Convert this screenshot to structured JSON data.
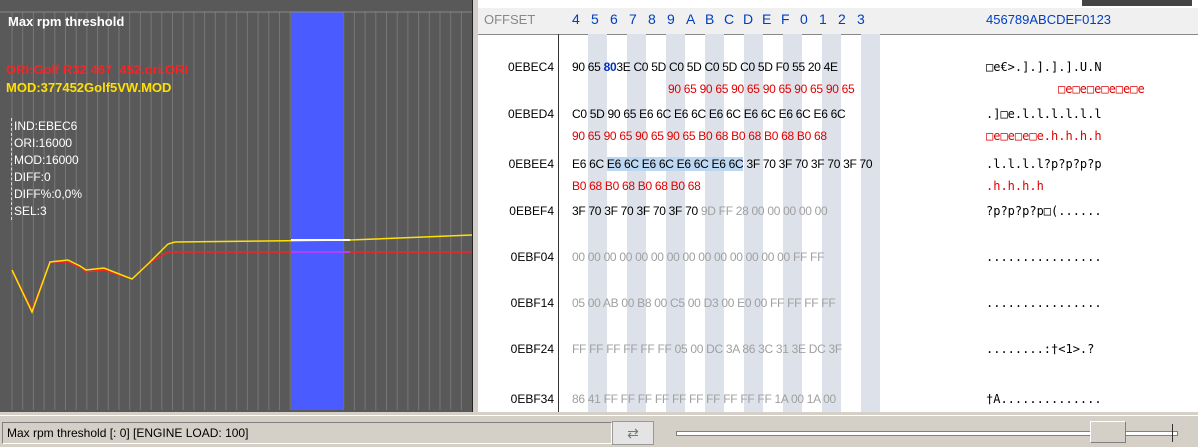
{
  "map": {
    "title": "Max rpm threshold",
    "ori_file": "ORI:Golf R32 467_452.ori.ORI",
    "mod_file": "MOD:377452Golf5VW.MOD",
    "info": [
      "IND:EBEC6",
      "ORI:16000",
      "MOD:16000",
      "DIFF:0",
      "DIFF%:0,0%",
      "SEL:3"
    ],
    "colors": {
      "ori": "#ff2020",
      "mod": "#ffe000",
      "selection": "#4a5cff",
      "diff": "#b040ff"
    }
  },
  "hex": {
    "offset_label": "OFFSET",
    "columns": [
      "4",
      "5",
      "6",
      "7",
      "8",
      "9",
      "A",
      "B",
      "C",
      "D",
      "E",
      "F",
      "0",
      "1",
      "2",
      "3"
    ],
    "ascii_header": "456789ABCDEF0123",
    "rows": [
      {
        "addr": "0EBEC4",
        "pre": "90 65 ",
        "bold": "80",
        "mid": "3E C0 5D C0 5D C0 5D C0 5D F0 55 20 4E",
        "hl": "",
        "post": "",
        "gray": "",
        "ascii": "□e€>.].].].].U.N",
        "diff_hex": "90 65 90 65 90 65 90 65 90 65 90 65",
        "diff_ascii": "□e□e□e□e□e□e"
      },
      {
        "addr": "0EBED4",
        "pre": "C0 5D 90 65 E6 6C E6 6C E6 6C E6 6C E6 6C E6 6C",
        "bold": "",
        "mid": "",
        "hl": "",
        "post": "",
        "gray": "",
        "ascii": ".]□e.l.l.l.l.l.l",
        "diff_hex": "90 65 90 65 90 65 90 65 B0 68 B0 68 B0 68 B0 68",
        "diff_ascii": "□e□e□e□e.h.h.h.h"
      },
      {
        "addr": "0EBEE4",
        "pre": "E6 6C ",
        "bold": "",
        "mid": "",
        "hl": "E6 6C E6 6C E6 6C E6 6C",
        "post": " 3F 70 3F 70 3F 70 3F 70",
        "gray": "",
        "ascii": ".l.l.l.l?p?p?p?p",
        "diff_hex": "B0 68 B0 68 B0 68 B0 68",
        "diff_ascii": ".h.h.h.h"
      },
      {
        "addr": "0EBEF4",
        "pre": "3F 70 3F 70 3F 70 3F 70 ",
        "bold": "",
        "mid": "",
        "hl": "",
        "post": "",
        "gray": "9D FF 28 00 00 00 00 00",
        "ascii": "?p?p?p?p□(......",
        "diff_hex": "",
        "diff_ascii": ""
      },
      {
        "addr": "0EBF04",
        "pre": "",
        "bold": "",
        "mid": "",
        "hl": "",
        "post": "",
        "gray": "00 00 00 00 00 00 00 00 00 00 00 00 00 00 FF FF",
        "ascii": "................",
        "diff_hex": "",
        "diff_ascii": ""
      },
      {
        "addr": "0EBF14",
        "pre": "",
        "bold": "",
        "mid": "",
        "hl": "",
        "post": "",
        "gray": "05 00 AB 00 B8 00 C5 00 D3 00 E0 00 FF FF FF FF",
        "ascii": "................",
        "diff_hex": "",
        "diff_ascii": ""
      },
      {
        "addr": "0EBF24",
        "pre": "",
        "bold": "",
        "mid": "",
        "hl": "",
        "post": "",
        "gray": "FF FF FF FF FF FF 05 00 DC 3A 86 3C 31 3E DC 3F",
        "ascii": "........:†<1>.?",
        "diff_hex": "",
        "diff_ascii": ""
      },
      {
        "addr": "0EBF34",
        "pre": "",
        "bold": "",
        "mid": "",
        "hl": "",
        "post": "",
        "gray": "86 41 FF FF FF FF FF FF FF FF FF FF 1A 00 1A 00",
        "ascii": "†A..............",
        "diff_hex": "",
        "diff_ascii": ""
      }
    ]
  },
  "status": {
    "text": "Max rpm threshold [: 0] [ENGINE LOAD: 100]",
    "swap_icon": "⇄",
    "slider_level": 0.9
  }
}
